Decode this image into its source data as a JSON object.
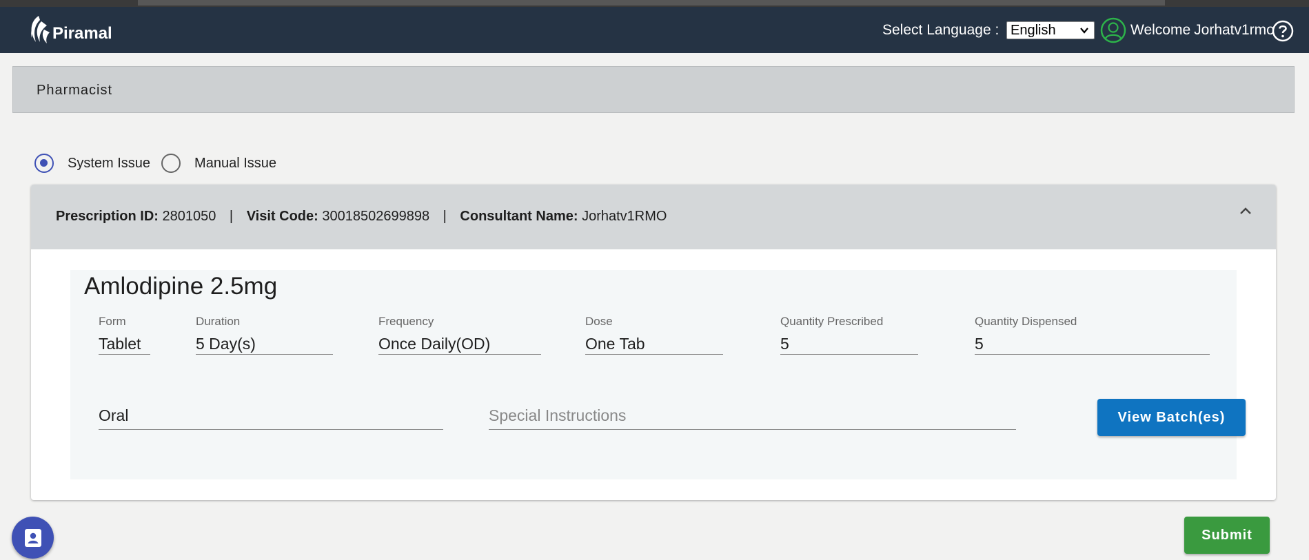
{
  "header": {
    "brand": "Piramal",
    "language_label": "Select Language :",
    "language_selected": "English",
    "welcome_label": "Welcome",
    "user_name": "Jorhatv1rmo",
    "colors": {
      "navbar": "#253344",
      "avatar_ring": "#2db34a"
    }
  },
  "page": {
    "title": "Pharmacist"
  },
  "issue_type": {
    "options": [
      {
        "label": "System Issue",
        "checked": true
      },
      {
        "label": "Manual Issue",
        "checked": false
      }
    ]
  },
  "prescription": {
    "id_label": "Prescription ID:",
    "id": "2801050",
    "visit_label": "Visit Code:",
    "visit_code": "30018502699898",
    "consultant_label": "Consultant Name:",
    "consultant": "Jorhatv1RMO",
    "separator": "|",
    "collapse_icon": "chevron-up-icon"
  },
  "medicine": {
    "name": "Amlodipine 2.5mg",
    "fields": {
      "form": {
        "label": "Form",
        "value": "Tablet"
      },
      "duration": {
        "label": "Duration",
        "value": "5 Day(s)"
      },
      "frequency": {
        "label": "Frequency",
        "value": "Once Daily(OD)"
      },
      "dose": {
        "label": "Dose",
        "value": "One Tab"
      },
      "qty_prescribed": {
        "label": "Quantity Prescribed",
        "value": "5"
      },
      "qty_dispensed": {
        "label": "Quantity Dispensed",
        "value": "5"
      }
    },
    "route": "Oral",
    "special_instructions_placeholder": "Special Instructions",
    "view_batch_label": "View Batch(es)"
  },
  "actions": {
    "submit_label": "Submit",
    "colors": {
      "primary": "#0f74c1",
      "submit": "#3a9a3f",
      "fab": "#3f51b5"
    },
    "fab_icon": "contact-card-icon"
  }
}
